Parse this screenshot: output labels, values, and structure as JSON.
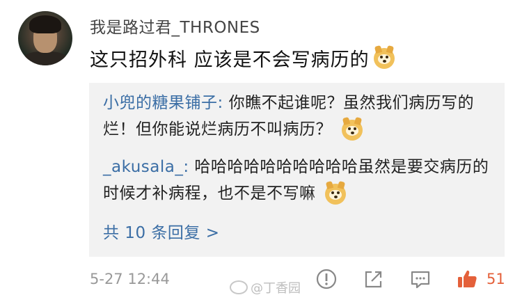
{
  "comment": {
    "username": "我是路过君_THRONES",
    "text": "这只招外科 应该是不会写病历的",
    "timestamp": "5-27 12:44",
    "like_count": "51"
  },
  "replies": [
    {
      "nick": "小兜的糖果铺子",
      "separator": ": ",
      "text": "你瞧不起谁呢？虽然我们病历写的烂！但你能说烂病历不叫病历？"
    },
    {
      "nick": "_akusala_",
      "separator": ": ",
      "text": "哈哈哈哈哈哈哈哈哈哈虽然是要交病历的时候才补病程，也不是不写嘛"
    }
  ],
  "more_replies": "共 10 条回复 >",
  "watermark": "@丁香园",
  "colors": {
    "link_blue": "#3b6ea5",
    "like_orange": "#e4603a",
    "reply_bg": "#f2f2f2",
    "meta_gray": "#999999"
  },
  "icons": [
    "doge-emoji",
    "report-icon",
    "share-icon",
    "comment-icon",
    "like-icon",
    "weibo-logo-icon"
  ]
}
